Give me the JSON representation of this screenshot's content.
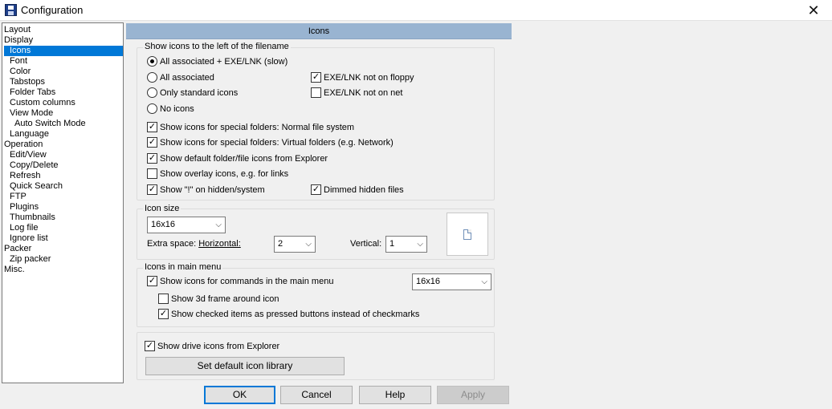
{
  "window": {
    "title": "Configuration",
    "close_glyph": "✕",
    "app_icon": "floppy-disk-icon"
  },
  "tree": [
    {
      "label": "Layout",
      "level": 0,
      "selected": false
    },
    {
      "label": "Display",
      "level": 0,
      "selected": false
    },
    {
      "label": "Icons",
      "level": 1,
      "selected": true
    },
    {
      "label": "Font",
      "level": 1,
      "selected": false
    },
    {
      "label": "Color",
      "level": 1,
      "selected": false
    },
    {
      "label": "Tabstops",
      "level": 1,
      "selected": false
    },
    {
      "label": "Folder Tabs",
      "level": 1,
      "selected": false
    },
    {
      "label": "Custom columns",
      "level": 1,
      "selected": false
    },
    {
      "label": "View Mode",
      "level": 1,
      "selected": false
    },
    {
      "label": "Auto Switch Mode",
      "level": 2,
      "selected": false
    },
    {
      "label": "Language",
      "level": 1,
      "selected": false
    },
    {
      "label": "Operation",
      "level": 0,
      "selected": false
    },
    {
      "label": "Edit/View",
      "level": 1,
      "selected": false
    },
    {
      "label": "Copy/Delete",
      "level": 1,
      "selected": false
    },
    {
      "label": "Refresh",
      "level": 1,
      "selected": false
    },
    {
      "label": "Quick Search",
      "level": 1,
      "selected": false
    },
    {
      "label": "FTP",
      "level": 1,
      "selected": false
    },
    {
      "label": "Plugins",
      "level": 1,
      "selected": false
    },
    {
      "label": "Thumbnails",
      "level": 1,
      "selected": false
    },
    {
      "label": "Log file",
      "level": 1,
      "selected": false
    },
    {
      "label": "Ignore list",
      "level": 1,
      "selected": false
    },
    {
      "label": "Packer",
      "level": 0,
      "selected": false
    },
    {
      "label": "Zip packer",
      "level": 1,
      "selected": false
    },
    {
      "label": "Misc.",
      "level": 0,
      "selected": false
    }
  ],
  "header": {
    "title": "Icons"
  },
  "show_icons_group": {
    "label": "Show icons to the left of the filename",
    "radio_all_exe": "All associated + EXE/LNK (slow)",
    "radio_all": "All associated",
    "radio_standard": "Only standard icons",
    "radio_none": "No icons",
    "selected_radio": "All associated + EXE/LNK (slow)",
    "exe_floppy": {
      "label": "EXE/LNK not on floppy",
      "checked": true
    },
    "exe_net": {
      "label": "EXE/LNK not on net",
      "checked": false
    },
    "special_normal": {
      "label": "Show icons for special folders: Normal file system",
      "checked": true
    },
    "special_virtual": {
      "label": "Show icons for special folders: Virtual folders (e.g. Network)",
      "checked": true
    },
    "default_explorer": {
      "label": "Show default folder/file icons from Explorer",
      "checked": true
    },
    "overlay": {
      "label": "Show overlay icons, e.g. for links",
      "checked": false
    },
    "hidden_system": {
      "label": "Show \"!\" on hidden/system",
      "checked": true
    },
    "dimmed_hidden": {
      "label": "Dimmed hidden files",
      "checked": true
    }
  },
  "icon_size_group": {
    "label": "Icon size",
    "size_value": "16x16",
    "extra_space_prefix": "Extra space: ",
    "horizontal_label": "Horizontal:",
    "horizontal_value": "2",
    "vertical_label": "Vertical:",
    "vertical_value": "1",
    "preview_icon": "document-icon"
  },
  "main_menu_group": {
    "label": "Icons in main menu",
    "show_commands": {
      "label": "Show icons for commands in the main menu",
      "checked": true
    },
    "menu_size_value": "16x16",
    "frame_3d": {
      "label": "Show 3d frame around icon",
      "checked": false
    },
    "checked_pressed": {
      "label": "Show checked items as pressed buttons instead of checkmarks",
      "checked": true
    }
  },
  "drive_group": {
    "drive_icons": {
      "label": "Show drive icons from Explorer",
      "checked": true
    },
    "set_default_button": "Set default icon library"
  },
  "buttons": {
    "ok": "OK",
    "cancel": "Cancel",
    "help": "Help",
    "apply": "Apply"
  },
  "glyphs": {
    "check": "✓",
    "chevron": "⌵"
  }
}
